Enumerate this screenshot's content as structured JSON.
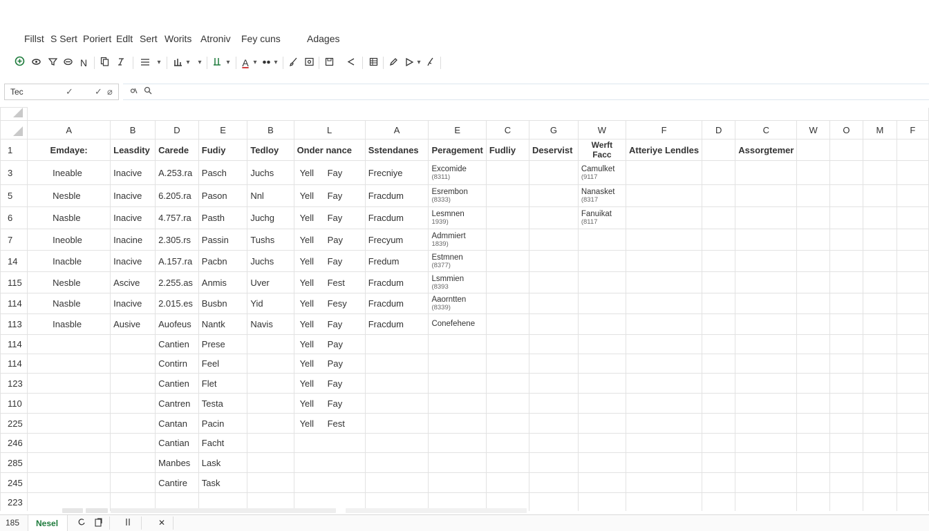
{
  "menu": [
    "Fillst",
    "S Sert",
    "Poriert",
    "Edlt",
    "Sert",
    "Worits",
    "Atroniv",
    "Fey cuns",
    "Adages"
  ],
  "toolbar": {
    "icons": [
      "add-circle-icon",
      "eye-icon",
      "filter-icon",
      "mask-icon",
      "bold-icon",
      "copy-icon",
      "italic-icon",
      "align-icon",
      "chevron-down-icon",
      "chart-icon",
      "chevron-down-icon",
      "bar-icon",
      "chevron-down-icon",
      "font-color-icon",
      "chevron-down-icon",
      "paint-icon",
      "chevron-down-icon",
      "brush-icon",
      "image-icon",
      "save-icon",
      "share-icon",
      "table-icon",
      "pen-icon",
      "shape-icon",
      "chevron-down-icon",
      "pin-icon"
    ],
    "glyphs": {
      "n_label": "N",
      "a_label": "A"
    }
  },
  "formula_bar": {
    "name_box": "Tec",
    "check1": "✓",
    "check2": "✓",
    "cancel": "⌀"
  },
  "columns": [
    "A",
    "B",
    "D",
    "E",
    "B",
    "L",
    "A",
    "E",
    "C",
    "G",
    "W",
    "F",
    "D",
    "C",
    "W",
    "O",
    "M",
    "F"
  ],
  "header_row": {
    "num": "1",
    "cells": [
      "Emdaye:",
      "Leasdity",
      "Carede",
      "Fudiy",
      "Tedloy",
      "Onder nance",
      "Sstendanes",
      "Peragement",
      "Fudliy",
      "Deservist",
      "Werft Facc",
      "Atteriye Lendles",
      "",
      "Assorgtemer",
      "",
      "",
      "",
      ""
    ]
  },
  "rows": [
    {
      "num": "3",
      "a": "Ineable",
      "b": "Inacive",
      "d": "A.253.ra",
      "e": "Pasch",
      "b2": "Juchs",
      "l1": "Yell",
      "l2": "Fay",
      "a2": "Frecniye",
      "e2": "Excomide",
      "e2s": "(8311)",
      "w": "Camulket",
      "ws": "(9117"
    },
    {
      "num": "5",
      "a": "Nesble",
      "b": "Inacive",
      "d": "6.205.ra",
      "e": "Pason",
      "b2": "Nnl",
      "l1": "Yell",
      "l2": "Fay",
      "a2": "Fracdum",
      "e2": "Esrembon",
      "e2s": "(8333)",
      "w": "Nanasket",
      "ws": "(8317"
    },
    {
      "num": "6",
      "a": "Nasble",
      "b": "Inacive",
      "d": "4.757.ra",
      "e": "Pasth",
      "b2": "Juchg",
      "l1": "Yell",
      "l2": "Fay",
      "a2": "Fracdum",
      "e2": "Lesmnen",
      "e2s": "1939)",
      "w": "Fanuikat",
      "ws": "(8117"
    },
    {
      "num": "7",
      "a": "Ineoble",
      "b": "Inacine",
      "d": "2.305.rs",
      "e": "Passin",
      "b2": "Tushs",
      "l1": "Yell",
      "l2": "Pay",
      "a2": "Frecyum",
      "e2": "Admmiert",
      "e2s": "1839)",
      "w": "",
      "ws": ""
    },
    {
      "num": "14",
      "a": "Inacble",
      "b": "Inacive",
      "d": "A.157.ra",
      "e": "Pacbn",
      "b2": "Juchs",
      "l1": "Yell",
      "l2": "Fay",
      "a2": "Fredum",
      "e2": "Estmnen",
      "e2s": "(8377)",
      "w": "",
      "ws": ""
    },
    {
      "num": "115",
      "a": "Nesble",
      "b": "Ascive",
      "d": "2.255.as",
      "e": "Anmis",
      "b2": "Uver",
      "l1": "Yell",
      "l2": "Fest",
      "a2": "Fracdum",
      "e2": "Lsmmien",
      "e2s": "(8393",
      "w": "",
      "ws": ""
    },
    {
      "num": "114",
      "a": "Nasble",
      "b": "Inacive",
      "d": "2.015.es",
      "e": "Busbn",
      "b2": "Yid",
      "l1": "Yell",
      "l2": "Fesy",
      "a2": "Fracdum",
      "e2": "Aaorntten",
      "e2s": "(8339)",
      "w": "",
      "ws": ""
    },
    {
      "num": "113",
      "a": "Inasble",
      "b": "Ausive",
      "d": "Auofeus",
      "e": "Nantk",
      "b2": "Navis",
      "l1": "Yell",
      "l2": "Fay",
      "a2": "Fracdum",
      "e2": "Conefehene",
      "e2s": "",
      "w": "",
      "ws": ""
    },
    {
      "num": "114",
      "a": "",
      "b": "",
      "d": "Cantien",
      "e": "Prese",
      "b2": "",
      "l1": "Yell",
      "l2": "Pay",
      "a2": "",
      "e2": "",
      "e2s": "",
      "w": "",
      "ws": ""
    },
    {
      "num": "114",
      "a": "",
      "b": "",
      "d": "Contirn",
      "e": "Feel",
      "b2": "",
      "l1": "Yell",
      "l2": "Pay",
      "a2": "",
      "e2": "",
      "e2s": "",
      "w": "",
      "ws": ""
    },
    {
      "num": "123",
      "a": "",
      "b": "",
      "d": "Cantien",
      "e": "Flet",
      "b2": "",
      "l1": "Yell",
      "l2": "Fay",
      "a2": "",
      "e2": "",
      "e2s": "",
      "w": "",
      "ws": ""
    },
    {
      "num": "110",
      "a": "",
      "b": "",
      "d": "Cantren",
      "e": "Testa",
      "b2": "",
      "l1": "Yell",
      "l2": "Fay",
      "a2": "",
      "e2": "",
      "e2s": "",
      "w": "",
      "ws": ""
    },
    {
      "num": "225",
      "a": "",
      "b": "",
      "d": "Cantan",
      "e": "Pacin",
      "b2": "",
      "l1": "Yell",
      "l2": "Fest",
      "a2": "",
      "e2": "",
      "e2s": "",
      "w": "",
      "ws": ""
    },
    {
      "num": "246",
      "a": "",
      "b": "",
      "d": "Cantian",
      "e": "Facht",
      "b2": "",
      "l1": "",
      "l2": "",
      "a2": "",
      "e2": "",
      "e2s": "",
      "w": "",
      "ws": ""
    },
    {
      "num": "285",
      "a": "",
      "b": "",
      "d": "Manbes",
      "e": "Lask",
      "b2": "",
      "l1": "",
      "l2": "",
      "a2": "",
      "e2": "",
      "e2s": "",
      "w": "",
      "ws": ""
    },
    {
      "num": "245",
      "a": "",
      "b": "",
      "d": "Cantire",
      "e": "Task",
      "b2": "",
      "l1": "",
      "l2": "",
      "a2": "",
      "e2": "",
      "e2s": "",
      "w": "",
      "ws": ""
    },
    {
      "num": "223",
      "a": "",
      "b": "",
      "d": "",
      "e": "",
      "b2": "",
      "l1": "",
      "l2": "",
      "a2": "",
      "e2": "",
      "e2s": "",
      "w": "",
      "ws": ""
    }
  ],
  "status": {
    "cell_count": "185",
    "sheet_name": "Nesel",
    "close": "✕"
  },
  "colors": {
    "accent_green": "#1e7b3c",
    "font_color_red": "#d23c3c"
  }
}
